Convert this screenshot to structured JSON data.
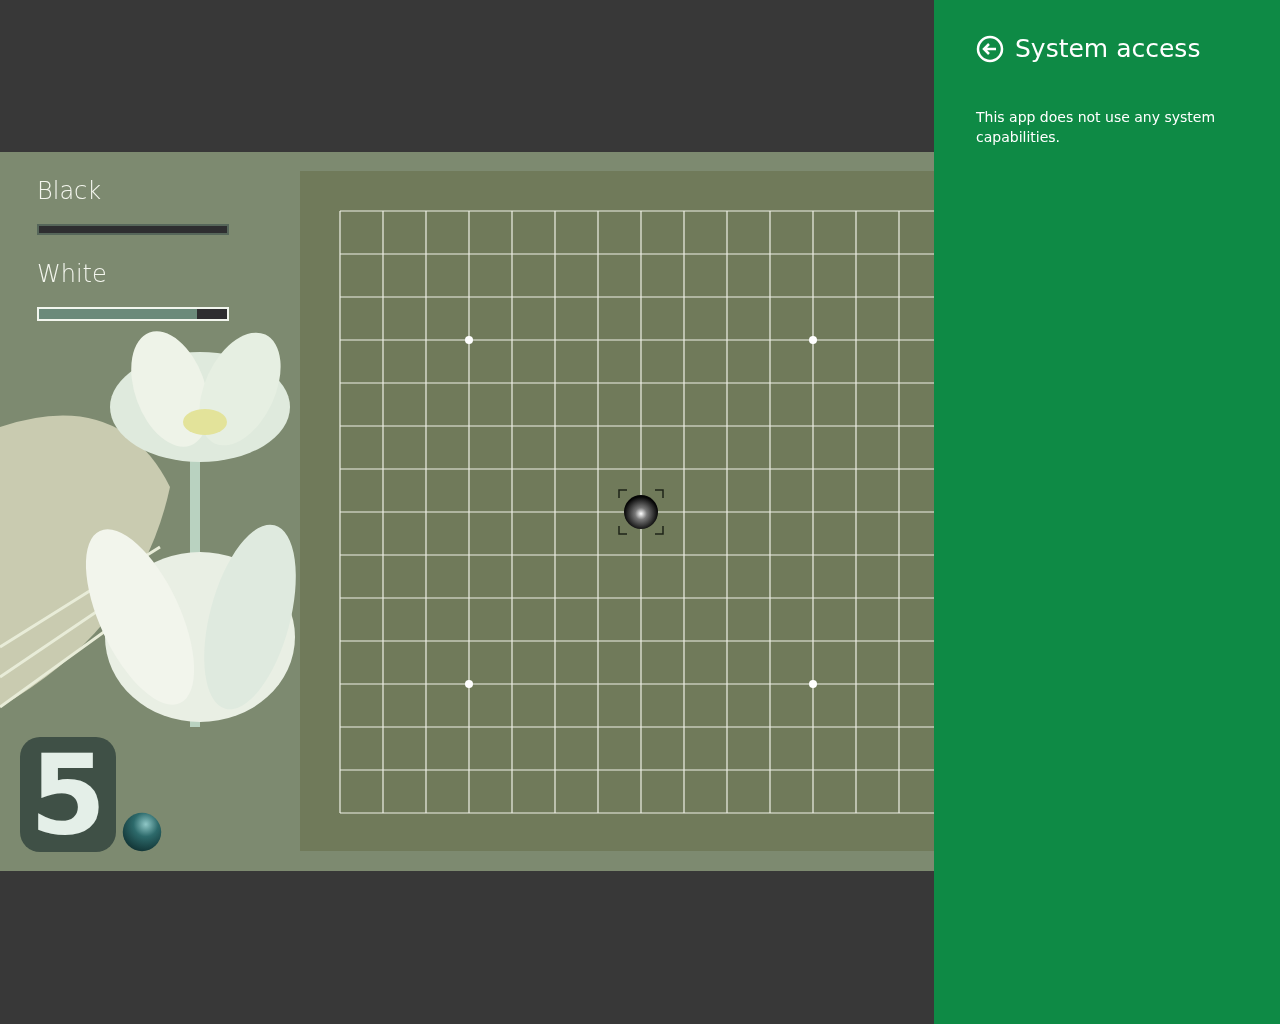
{
  "players": [
    {
      "name": "Black",
      "level": 1,
      "active": false
    },
    {
      "name": "White",
      "level": 0.16,
      "active": true
    }
  ],
  "level_number": "5",
  "board": {
    "stones": [
      {
        "kind": "black",
        "last_move": true
      }
    ]
  },
  "panel": {
    "title": "System access",
    "message": "This app does not use any system capabilities."
  }
}
